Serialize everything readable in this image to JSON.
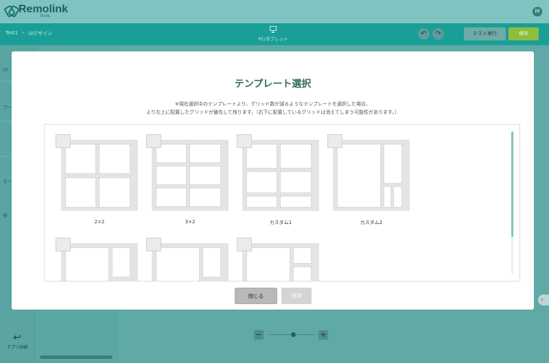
{
  "app": {
    "logo_name": "Remolink",
    "logo_sub": "Tools",
    "user_initial": "M"
  },
  "subbar": {
    "breadcrumb": [
      "Test1",
      "›",
      "UIデザイン"
    ],
    "device_label": "PC/タブレット",
    "undo_icon": "undo-icon",
    "redo_icon": "redo-icon",
    "test_label": "テスト実行",
    "save_label": "保存"
  },
  "leftnav": {
    "back_label": "アプリ詳細",
    "fragments": [
      "UI",
      "ワー",
      "モー",
      "保"
    ]
  },
  "modal": {
    "title": "テンプレート選択",
    "desc_line1": "※現在選択中のテンプレートより、グリッド数が減るようなテンプレートを選択した場合、",
    "desc_line2": "より左上に配置したグリッドが優先して残ります。（右下に配置しているグリッドは消えてしまう可能性があります。）",
    "templates": [
      {
        "label": "2×2"
      },
      {
        "label": "3×2"
      },
      {
        "label": "カスタム1"
      },
      {
        "label": "カスタム2"
      }
    ],
    "close_label": "閉じる",
    "add_label": "追加"
  },
  "colors": {
    "accent": "#1a9f97",
    "save": "#8cbf3d",
    "title": "#2f6b5e",
    "scroll": "#7cc6b3"
  }
}
